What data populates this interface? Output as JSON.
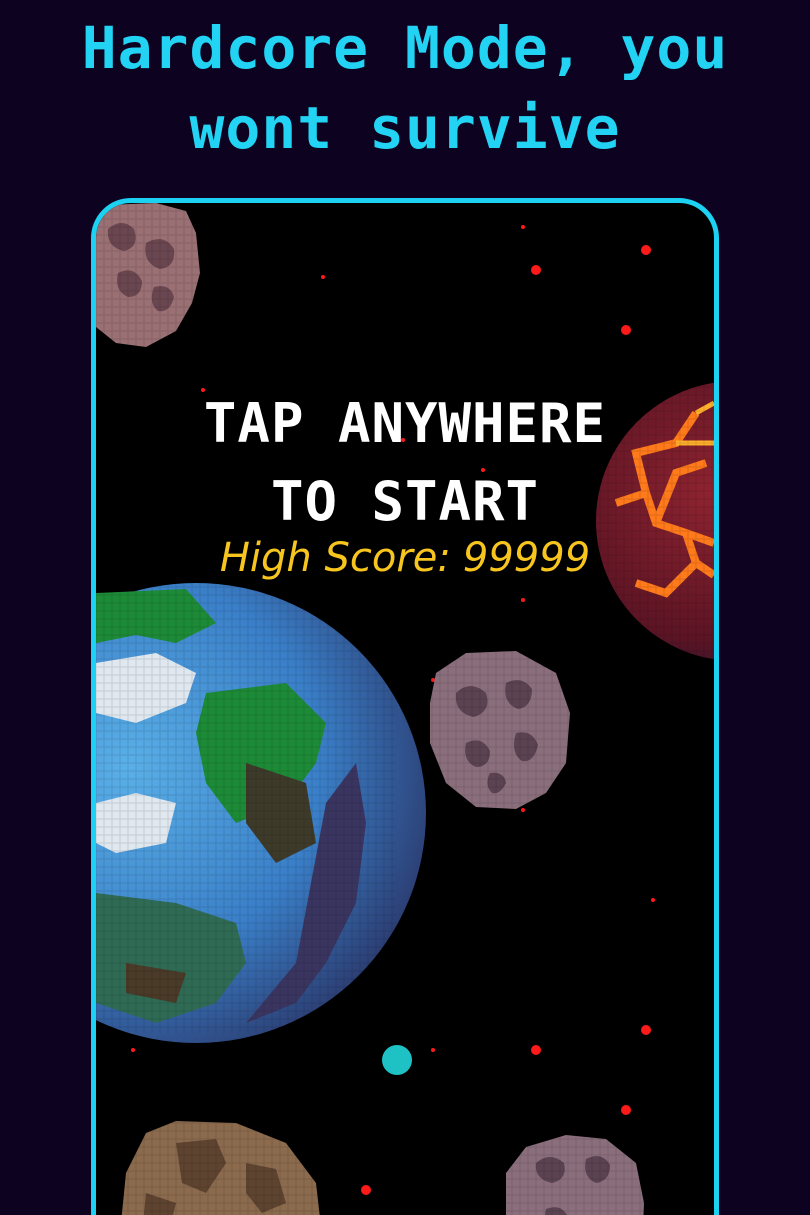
{
  "header": {
    "line1": "Hardcore Mode, you",
    "line2": "wont survive"
  },
  "game": {
    "prompt_line1": "TAP ANYWHERE",
    "prompt_line2": "TO START",
    "high_score_label": "High Score:",
    "high_score_value": "99999"
  },
  "colors": {
    "background": "#0d0320",
    "accent": "#22d3f4",
    "frame_border": "#1bd2f2",
    "high_score": "#f7c51e",
    "player": "#1ec2c4",
    "stars": "#ff1a1a"
  },
  "sprites": {
    "planets": [
      "earth-planet",
      "lava-planet"
    ],
    "asteroids": [
      "asteroid-top-left",
      "asteroid-center",
      "asteroid-bottom-right",
      "asteroid-bottom-left-brown"
    ]
  }
}
